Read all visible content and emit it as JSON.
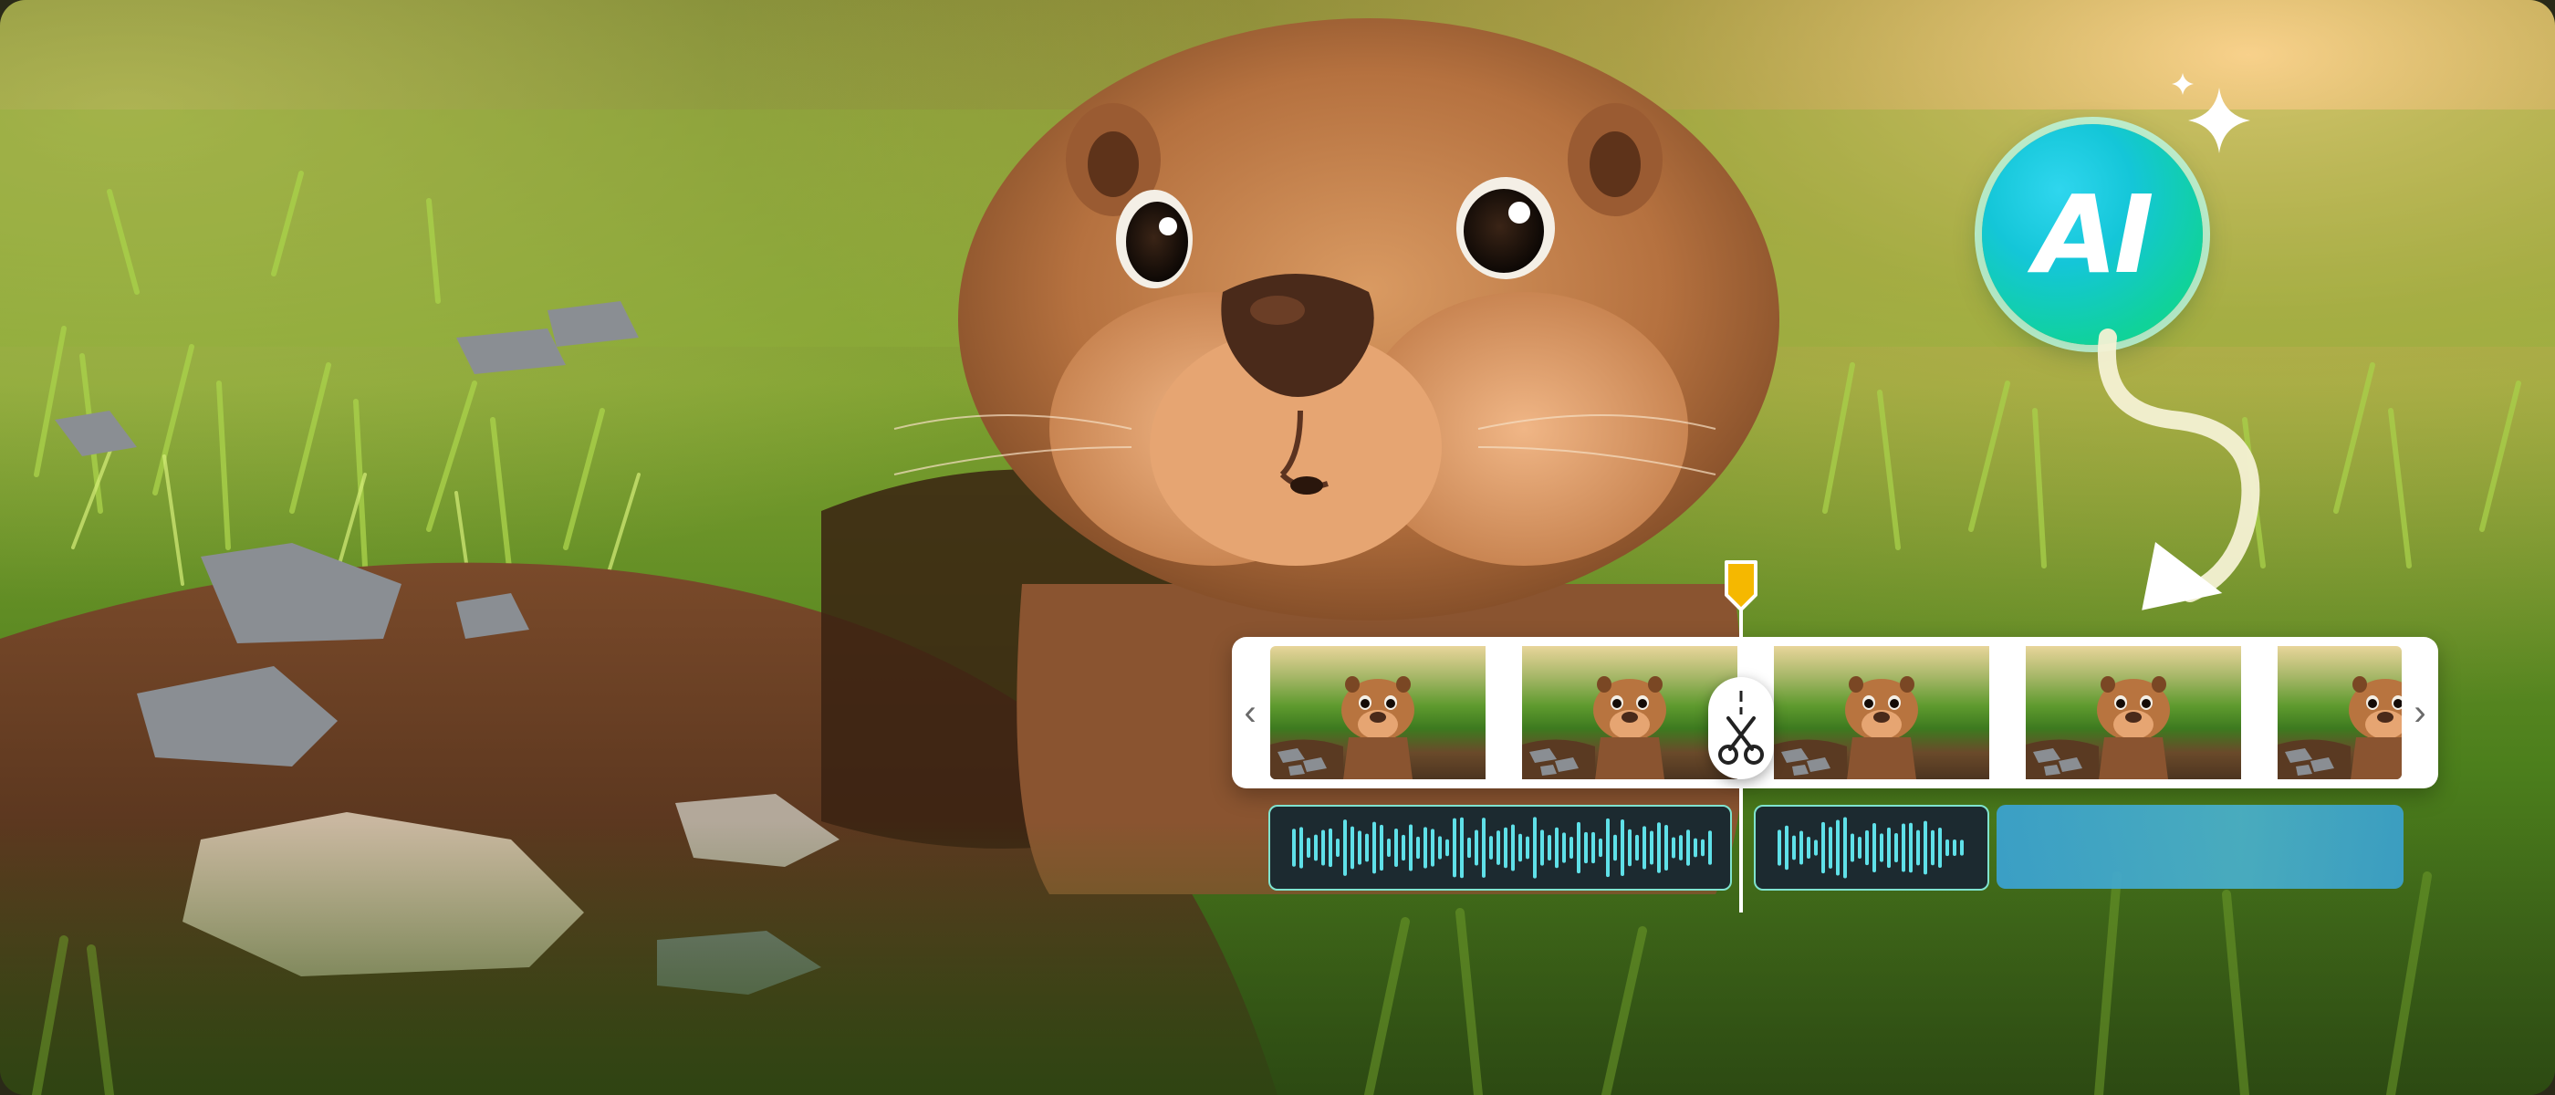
{
  "badge": {
    "label": "AI"
  },
  "timeline": {
    "prev_icon": "chevron-left-icon",
    "next_icon": "chevron-right-icon",
    "prev_glyph": "‹",
    "next_glyph": "›",
    "frame_count": 5,
    "cut_icon": "scissors-icon"
  },
  "audio": {
    "clips": [
      {
        "name": "audio-clip-1",
        "state": "waveform"
      },
      {
        "name": "audio-clip-2",
        "state": "waveform"
      },
      {
        "name": "audio-clip-3",
        "state": "placeholder"
      }
    ]
  },
  "colors": {
    "playhead": "#f5b800",
    "badge_start": "#2fd6ee",
    "badge_end": "#16de86",
    "waveform": "#5fe0e8",
    "clip_border": "#7fe3cf"
  }
}
